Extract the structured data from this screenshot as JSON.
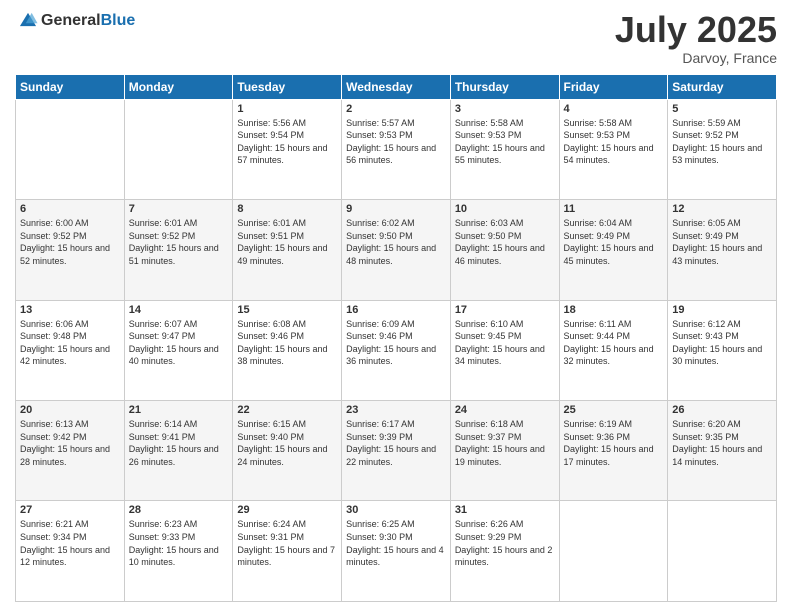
{
  "logo": {
    "general": "General",
    "blue": "Blue"
  },
  "header": {
    "month": "July 2025",
    "location": "Darvoy, France"
  },
  "weekdays": [
    "Sunday",
    "Monday",
    "Tuesday",
    "Wednesday",
    "Thursday",
    "Friday",
    "Saturday"
  ],
  "weeks": [
    [
      {
        "day": "",
        "info": ""
      },
      {
        "day": "",
        "info": ""
      },
      {
        "day": "1",
        "info": "Sunrise: 5:56 AM\nSunset: 9:54 PM\nDaylight: 15 hours and 57 minutes."
      },
      {
        "day": "2",
        "info": "Sunrise: 5:57 AM\nSunset: 9:53 PM\nDaylight: 15 hours and 56 minutes."
      },
      {
        "day": "3",
        "info": "Sunrise: 5:58 AM\nSunset: 9:53 PM\nDaylight: 15 hours and 55 minutes."
      },
      {
        "day": "4",
        "info": "Sunrise: 5:58 AM\nSunset: 9:53 PM\nDaylight: 15 hours and 54 minutes."
      },
      {
        "day": "5",
        "info": "Sunrise: 5:59 AM\nSunset: 9:52 PM\nDaylight: 15 hours and 53 minutes."
      }
    ],
    [
      {
        "day": "6",
        "info": "Sunrise: 6:00 AM\nSunset: 9:52 PM\nDaylight: 15 hours and 52 minutes."
      },
      {
        "day": "7",
        "info": "Sunrise: 6:01 AM\nSunset: 9:52 PM\nDaylight: 15 hours and 51 minutes."
      },
      {
        "day": "8",
        "info": "Sunrise: 6:01 AM\nSunset: 9:51 PM\nDaylight: 15 hours and 49 minutes."
      },
      {
        "day": "9",
        "info": "Sunrise: 6:02 AM\nSunset: 9:50 PM\nDaylight: 15 hours and 48 minutes."
      },
      {
        "day": "10",
        "info": "Sunrise: 6:03 AM\nSunset: 9:50 PM\nDaylight: 15 hours and 46 minutes."
      },
      {
        "day": "11",
        "info": "Sunrise: 6:04 AM\nSunset: 9:49 PM\nDaylight: 15 hours and 45 minutes."
      },
      {
        "day": "12",
        "info": "Sunrise: 6:05 AM\nSunset: 9:49 PM\nDaylight: 15 hours and 43 minutes."
      }
    ],
    [
      {
        "day": "13",
        "info": "Sunrise: 6:06 AM\nSunset: 9:48 PM\nDaylight: 15 hours and 42 minutes."
      },
      {
        "day": "14",
        "info": "Sunrise: 6:07 AM\nSunset: 9:47 PM\nDaylight: 15 hours and 40 minutes."
      },
      {
        "day": "15",
        "info": "Sunrise: 6:08 AM\nSunset: 9:46 PM\nDaylight: 15 hours and 38 minutes."
      },
      {
        "day": "16",
        "info": "Sunrise: 6:09 AM\nSunset: 9:46 PM\nDaylight: 15 hours and 36 minutes."
      },
      {
        "day": "17",
        "info": "Sunrise: 6:10 AM\nSunset: 9:45 PM\nDaylight: 15 hours and 34 minutes."
      },
      {
        "day": "18",
        "info": "Sunrise: 6:11 AM\nSunset: 9:44 PM\nDaylight: 15 hours and 32 minutes."
      },
      {
        "day": "19",
        "info": "Sunrise: 6:12 AM\nSunset: 9:43 PM\nDaylight: 15 hours and 30 minutes."
      }
    ],
    [
      {
        "day": "20",
        "info": "Sunrise: 6:13 AM\nSunset: 9:42 PM\nDaylight: 15 hours and 28 minutes."
      },
      {
        "day": "21",
        "info": "Sunrise: 6:14 AM\nSunset: 9:41 PM\nDaylight: 15 hours and 26 minutes."
      },
      {
        "day": "22",
        "info": "Sunrise: 6:15 AM\nSunset: 9:40 PM\nDaylight: 15 hours and 24 minutes."
      },
      {
        "day": "23",
        "info": "Sunrise: 6:17 AM\nSunset: 9:39 PM\nDaylight: 15 hours and 22 minutes."
      },
      {
        "day": "24",
        "info": "Sunrise: 6:18 AM\nSunset: 9:37 PM\nDaylight: 15 hours and 19 minutes."
      },
      {
        "day": "25",
        "info": "Sunrise: 6:19 AM\nSunset: 9:36 PM\nDaylight: 15 hours and 17 minutes."
      },
      {
        "day": "26",
        "info": "Sunrise: 6:20 AM\nSunset: 9:35 PM\nDaylight: 15 hours and 14 minutes."
      }
    ],
    [
      {
        "day": "27",
        "info": "Sunrise: 6:21 AM\nSunset: 9:34 PM\nDaylight: 15 hours and 12 minutes."
      },
      {
        "day": "28",
        "info": "Sunrise: 6:23 AM\nSunset: 9:33 PM\nDaylight: 15 hours and 10 minutes."
      },
      {
        "day": "29",
        "info": "Sunrise: 6:24 AM\nSunset: 9:31 PM\nDaylight: 15 hours and 7 minutes."
      },
      {
        "day": "30",
        "info": "Sunrise: 6:25 AM\nSunset: 9:30 PM\nDaylight: 15 hours and 4 minutes."
      },
      {
        "day": "31",
        "info": "Sunrise: 6:26 AM\nSunset: 9:29 PM\nDaylight: 15 hours and 2 minutes."
      },
      {
        "day": "",
        "info": ""
      },
      {
        "day": "",
        "info": ""
      }
    ]
  ]
}
